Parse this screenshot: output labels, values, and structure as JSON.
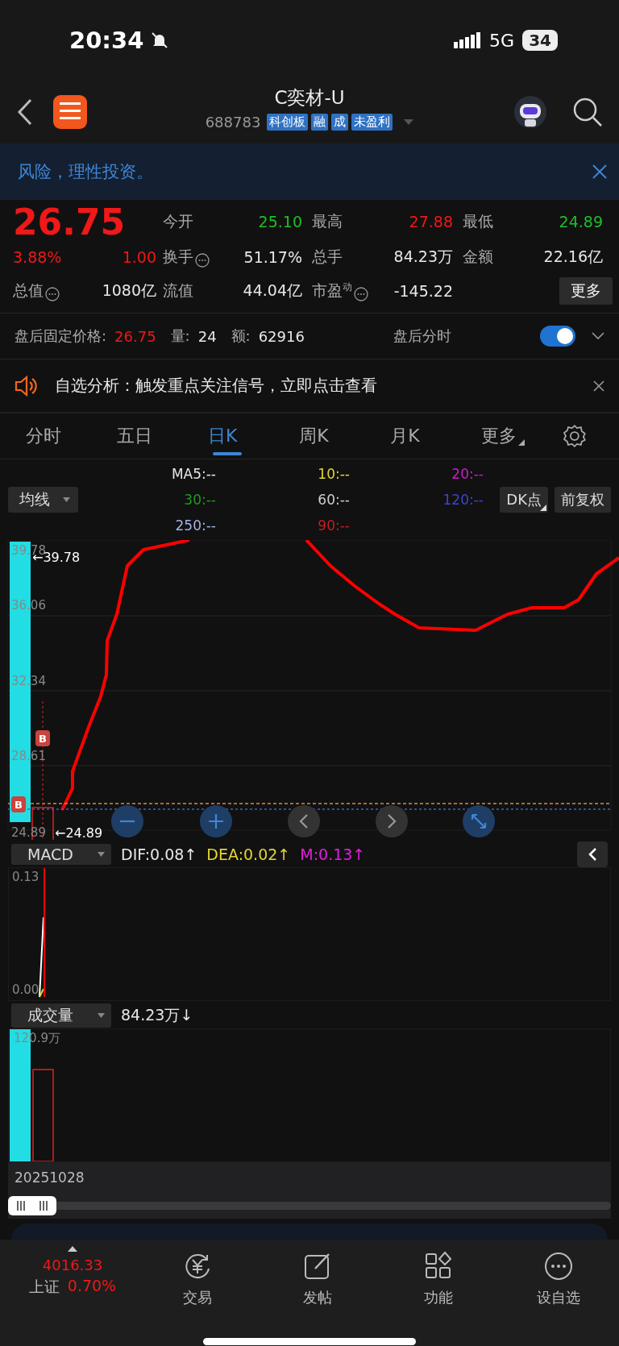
{
  "status_bar": {
    "time": "20:34",
    "network": "5G",
    "battery": "34"
  },
  "header": {
    "title": "C奕材-U",
    "code": "688783",
    "tags": [
      "科创板",
      "融",
      "成",
      "未盈利"
    ]
  },
  "risk_banner": {
    "text": "风险，理性投资。"
  },
  "quote": {
    "price": "26.75",
    "change_pct": "3.88%",
    "change": "1.00",
    "color": "#f01818",
    "market_cap": {
      "label": "总值",
      "value": "1080亿",
      "info": true
    },
    "stats": [
      {
        "label": "今开",
        "value": "25.10",
        "color": "#1fbf2a"
      },
      {
        "label": "最高",
        "value": "27.88",
        "color": "#f01818"
      },
      {
        "label": "最低",
        "value": "24.89",
        "color": "#1fbf2a"
      },
      {
        "label": "换手",
        "value": "51.17%",
        "color": "#e8e8e8",
        "info": true
      },
      {
        "label": "总手",
        "value": "84.23万",
        "color": "#e8e8e8"
      },
      {
        "label": "金额",
        "value": "22.16亿",
        "color": "#e8e8e8"
      },
      {
        "label": "流值",
        "value": "44.04亿",
        "color": "#e8e8e8"
      },
      {
        "label": "市盈$^{动}$",
        "value": "-145.22",
        "color": "#e8e8e8",
        "info": true
      }
    ],
    "more_button": "更多"
  },
  "after_hours": {
    "label": "盘后固定价格:",
    "price": "26.75",
    "volume_label": "量:",
    "volume": "24",
    "amount_label": "额:",
    "amount": "62916",
    "toggle_label": "盘后分时",
    "toggle_on": true
  },
  "notice": {
    "text": "自选分析：触发重点关注信号，立即点击查看"
  },
  "tabs": [
    {
      "label": "分时",
      "selected": false,
      "kind": "tab"
    },
    {
      "label": "五日",
      "selected": false,
      "kind": "tab"
    },
    {
      "label": "日K",
      "selected": true,
      "kind": "tab"
    },
    {
      "label": "周K",
      "selected": false,
      "kind": "tab"
    },
    {
      "label": "月K",
      "selected": false,
      "kind": "tab"
    },
    {
      "label": "更多",
      "selected": false,
      "kind": "menu"
    }
  ],
  "ma_legend": {
    "selector": "均线",
    "dk_button": "DK点",
    "adjust_button": "前复权",
    "items": [
      {
        "text": "MA5:--",
        "color": "#e6e6e6"
      },
      {
        "text": "10:--",
        "color": "#e3d534"
      },
      {
        "text": "20:--",
        "color": "#c61fc6"
      },
      {
        "text": "30:--",
        "color": "#1f9a1f"
      },
      {
        "text": "60:--",
        "color": "#cfcfcf"
      },
      {
        "text": "120:--",
        "color": "#3c46c8"
      },
      {
        "text": "250:--",
        "color": "#9fb3e6"
      },
      {
        "text": "90:--",
        "color": "#c81e1e"
      }
    ]
  },
  "price_chart": {
    "y_labels": [
      "39.78",
      "36.06",
      "32.34",
      "28.61",
      "24.89"
    ],
    "high_marker": "←39.78",
    "low_marker": "←24.89",
    "signals": [
      "B",
      "B"
    ]
  },
  "macd": {
    "selector": "MACD",
    "dif": "DIF:0.08↑",
    "dea": "DEA:0.02↑",
    "m": "M:0.13↑",
    "y_labels": [
      "0.13",
      "0.00"
    ]
  },
  "volume": {
    "selector": "成交量",
    "value": "84.23万↓",
    "y_label": "120.9万"
  },
  "date": "20251028",
  "bottom_bar": {
    "index_value": "4016.33",
    "index_name": "上证",
    "index_change": "0.70%",
    "items": [
      {
        "label": "交易",
        "kind": "trade"
      },
      {
        "label": "发帖",
        "kind": "post"
      },
      {
        "label": "功能",
        "kind": "apps"
      },
      {
        "label": "设自选",
        "kind": "more"
      }
    ]
  }
}
